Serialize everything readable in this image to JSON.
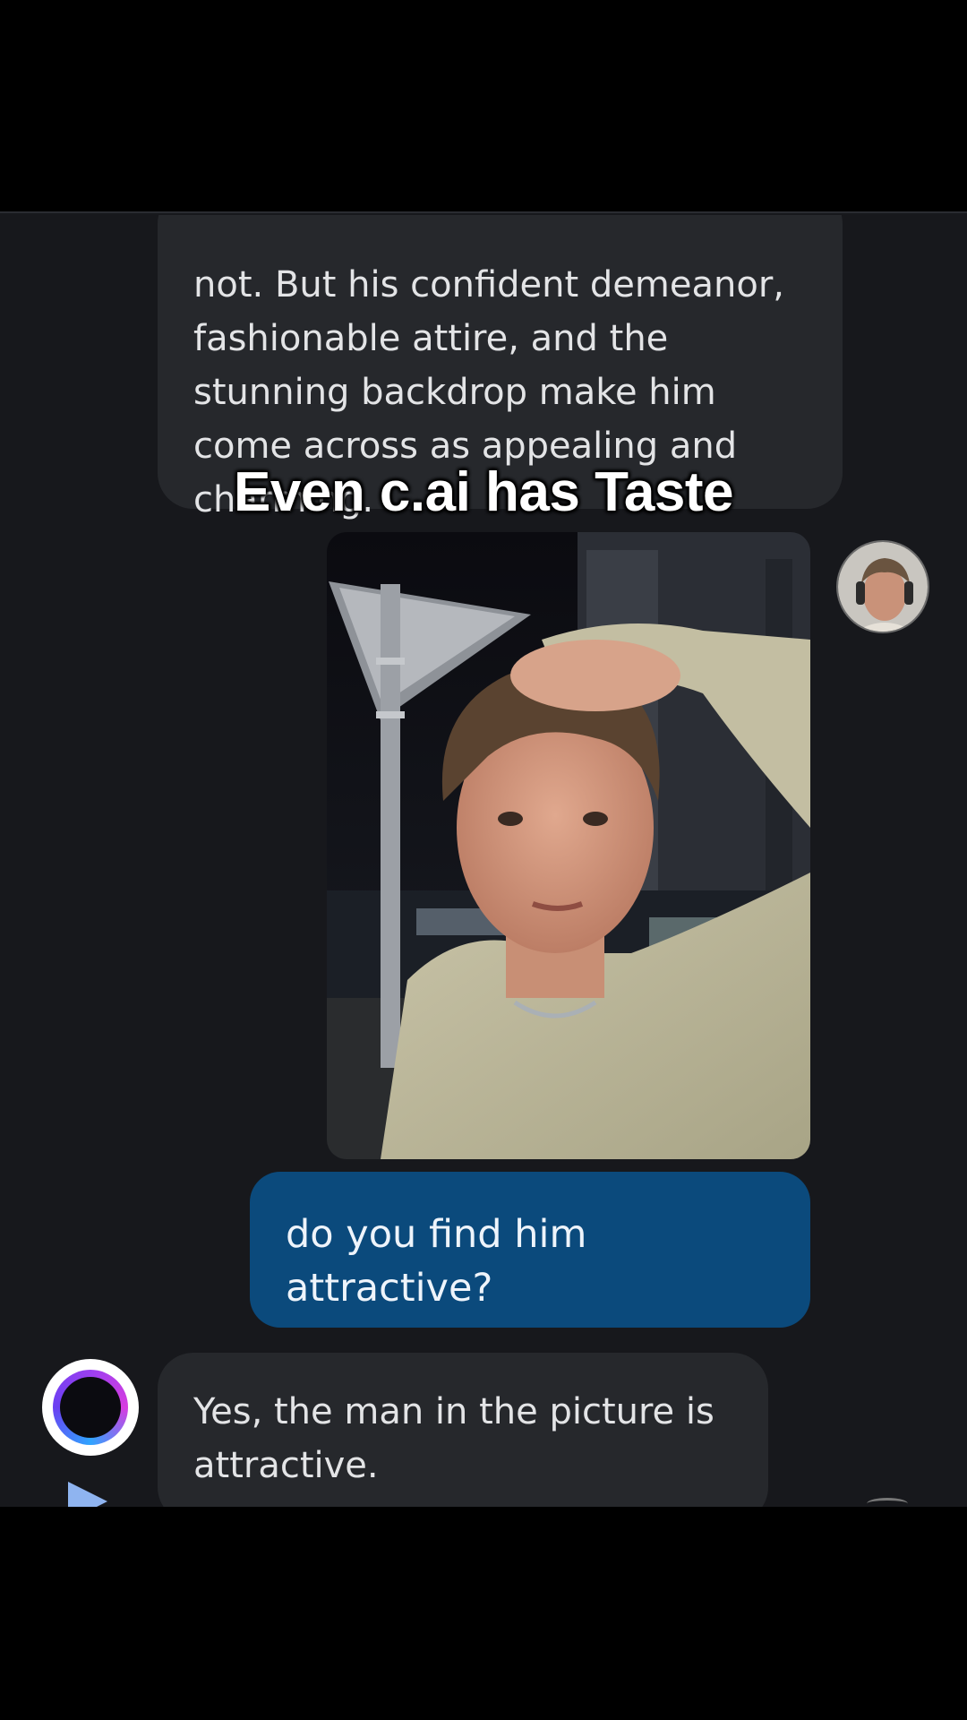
{
  "caption": "Even c.ai has Taste",
  "messages": {
    "bot_top": {
      "lines": [
        "not. But his confident demeanor,",
        "fashionable attire, and the",
        "stunning backdrop make him",
        "come across as appealing and",
        "charming."
      ]
    },
    "user": {
      "text": "do you find him attractive?"
    },
    "bot_bottom": {
      "lines": [
        "Yes, the man in the picture is",
        "attractive."
      ]
    }
  },
  "icons": {
    "bot_avatar": "character-ai-ring-icon",
    "play": "play-icon",
    "user_avatar": "user-avatar"
  },
  "colors": {
    "user_bubble": "#0b4a7c",
    "bot_bubble": "#26282c",
    "chat_background": "#17181c"
  }
}
